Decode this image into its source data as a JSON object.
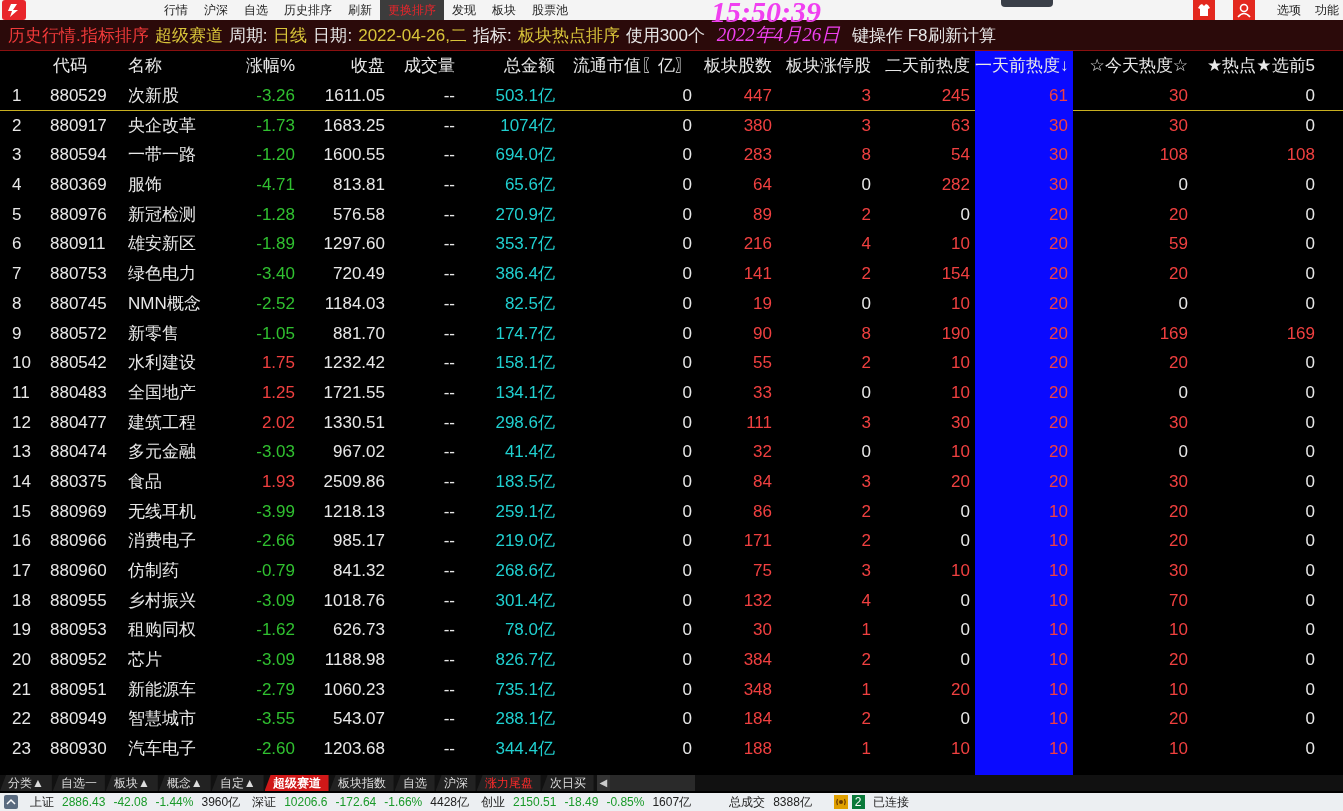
{
  "menu": [
    {
      "label": "行情",
      "selected": false
    },
    {
      "label": "沪深",
      "selected": false
    },
    {
      "label": "自选",
      "selected": false
    },
    {
      "label": "历史排序",
      "selected": false
    },
    {
      "label": "刷新",
      "selected": false
    },
    {
      "label": "更换排序",
      "selected": true
    },
    {
      "label": "发现",
      "selected": false
    },
    {
      "label": "板块",
      "selected": false
    },
    {
      "label": "股票池",
      "selected": false
    }
  ],
  "top_right": [
    "选项",
    "功能"
  ],
  "clock": {
    "time": "15:50:39",
    "date": "2022年4月26日"
  },
  "info_bar": {
    "title": "历史行情.指标排序",
    "track": "超级赛道",
    "period_label": "周期:",
    "period": "日线",
    "date_label": "日期:",
    "date": "2022-04-26,二",
    "indicator_label": "指标:",
    "indicator": "板块热点排序",
    "note_start": "使用300个",
    "note_end": "键操作 F8刷新计算"
  },
  "columns": [
    {
      "label": "代码",
      "sorted": false
    },
    {
      "label": "名称",
      "sorted": false
    },
    {
      "label": "涨幅%",
      "sorted": false
    },
    {
      "label": "收盘",
      "sorted": false
    },
    {
      "label": "成交量",
      "sorted": false
    },
    {
      "label": "总金额",
      "sorted": false
    },
    {
      "label": "流通市值〖亿〗",
      "sorted": false
    },
    {
      "label": "板块股数",
      "sorted": false
    },
    {
      "label": "板块涨停股",
      "sorted": false
    },
    {
      "label": "二天前热度",
      "sorted": false
    },
    {
      "label": "一天前热度↓",
      "sorted": true
    },
    {
      "label": "☆今天热度☆",
      "sorted": false
    },
    {
      "label": "★热点★选前5",
      "sorted": false
    }
  ],
  "rows": [
    {
      "selected": true,
      "up": false,
      "cells": [
        "1",
        "880529",
        "次新股",
        "-3.26",
        "1611.05",
        "--",
        "503.1亿",
        "0",
        "447",
        "3",
        "245",
        "61",
        "30",
        "0"
      ]
    },
    {
      "selected": false,
      "up": false,
      "cells": [
        "2",
        "880917",
        "央企改革",
        "-1.73",
        "1683.25",
        "--",
        "1074亿",
        "0",
        "380",
        "3",
        "63",
        "30",
        "30",
        "0"
      ]
    },
    {
      "selected": false,
      "up": false,
      "cells": [
        "3",
        "880594",
        "一带一路",
        "-1.20",
        "1600.55",
        "--",
        "694.0亿",
        "0",
        "283",
        "8",
        "54",
        "30",
        "108",
        "108"
      ]
    },
    {
      "selected": false,
      "up": false,
      "cells": [
        "4",
        "880369",
        "服饰",
        "-4.71",
        "813.81",
        "--",
        "65.6亿",
        "0",
        "64",
        "0",
        "282",
        "30",
        "0",
        "0"
      ]
    },
    {
      "selected": false,
      "up": false,
      "cells": [
        "5",
        "880976",
        "新冠检测",
        "-1.28",
        "576.58",
        "--",
        "270.9亿",
        "0",
        "89",
        "2",
        "0",
        "20",
        "20",
        "0"
      ]
    },
    {
      "selected": false,
      "up": false,
      "cells": [
        "6",
        "880911",
        "雄安新区",
        "-1.89",
        "1297.60",
        "--",
        "353.7亿",
        "0",
        "216",
        "4",
        "10",
        "20",
        "59",
        "0"
      ]
    },
    {
      "selected": false,
      "up": false,
      "cells": [
        "7",
        "880753",
        "绿色电力",
        "-3.40",
        "720.49",
        "--",
        "386.4亿",
        "0",
        "141",
        "2",
        "154",
        "20",
        "20",
        "0"
      ]
    },
    {
      "selected": false,
      "up": false,
      "cells": [
        "8",
        "880745",
        "NMN概念",
        "-2.52",
        "1184.03",
        "--",
        "82.5亿",
        "0",
        "19",
        "0",
        "10",
        "20",
        "0",
        "0"
      ]
    },
    {
      "selected": false,
      "up": false,
      "cells": [
        "9",
        "880572",
        "新零售",
        "-1.05",
        "881.70",
        "--",
        "174.7亿",
        "0",
        "90",
        "8",
        "190",
        "20",
        "169",
        "169"
      ]
    },
    {
      "selected": false,
      "up": true,
      "cells": [
        "10",
        "880542",
        "水利建设",
        "1.75",
        "1232.42",
        "--",
        "158.1亿",
        "0",
        "55",
        "2",
        "10",
        "20",
        "20",
        "0"
      ]
    },
    {
      "selected": false,
      "up": true,
      "cells": [
        "11",
        "880483",
        "全国地产",
        "1.25",
        "1721.55",
        "--",
        "134.1亿",
        "0",
        "33",
        "0",
        "10",
        "20",
        "0",
        "0"
      ]
    },
    {
      "selected": false,
      "up": true,
      "cells": [
        "12",
        "880477",
        "建筑工程",
        "2.02",
        "1330.51",
        "--",
        "298.6亿",
        "0",
        "111",
        "3",
        "30",
        "20",
        "30",
        "0"
      ]
    },
    {
      "selected": false,
      "up": false,
      "cells": [
        "13",
        "880474",
        "多元金融",
        "-3.03",
        "967.02",
        "--",
        "41.4亿",
        "0",
        "32",
        "0",
        "10",
        "20",
        "0",
        "0"
      ]
    },
    {
      "selected": false,
      "up": true,
      "cells": [
        "14",
        "880375",
        "食品",
        "1.93",
        "2509.86",
        "--",
        "183.5亿",
        "0",
        "84",
        "3",
        "20",
        "20",
        "30",
        "0"
      ]
    },
    {
      "selected": false,
      "up": false,
      "cells": [
        "15",
        "880969",
        "无线耳机",
        "-3.99",
        "1218.13",
        "--",
        "259.1亿",
        "0",
        "86",
        "2",
        "0",
        "10",
        "20",
        "0"
      ]
    },
    {
      "selected": false,
      "up": false,
      "cells": [
        "16",
        "880966",
        "消费电子",
        "-2.66",
        "985.17",
        "--",
        "219.0亿",
        "0",
        "171",
        "2",
        "0",
        "10",
        "20",
        "0"
      ]
    },
    {
      "selected": false,
      "up": false,
      "cells": [
        "17",
        "880960",
        "仿制药",
        "-0.79",
        "841.32",
        "--",
        "268.6亿",
        "0",
        "75",
        "3",
        "10",
        "10",
        "30",
        "0"
      ]
    },
    {
      "selected": false,
      "up": false,
      "cells": [
        "18",
        "880955",
        "乡村振兴",
        "-3.09",
        "1018.76",
        "--",
        "301.4亿",
        "0",
        "132",
        "4",
        "0",
        "10",
        "70",
        "0"
      ]
    },
    {
      "selected": false,
      "up": false,
      "cells": [
        "19",
        "880953",
        "租购同权",
        "-1.62",
        "626.73",
        "--",
        "78.0亿",
        "0",
        "30",
        "1",
        "0",
        "10",
        "10",
        "0"
      ]
    },
    {
      "selected": false,
      "up": false,
      "cells": [
        "20",
        "880952",
        "芯片",
        "-3.09",
        "1188.98",
        "--",
        "826.7亿",
        "0",
        "384",
        "2",
        "0",
        "10",
        "20",
        "0"
      ]
    },
    {
      "selected": false,
      "up": false,
      "cells": [
        "21",
        "880951",
        "新能源车",
        "-2.79",
        "1060.23",
        "--",
        "735.1亿",
        "0",
        "348",
        "1",
        "20",
        "10",
        "10",
        "0"
      ]
    },
    {
      "selected": false,
      "up": false,
      "cells": [
        "22",
        "880949",
        "智慧城市",
        "-3.55",
        "543.07",
        "--",
        "288.1亿",
        "0",
        "184",
        "2",
        "0",
        "10",
        "20",
        "0"
      ]
    },
    {
      "selected": false,
      "up": false,
      "cells": [
        "23",
        "880930",
        "汽车电子",
        "-2.60",
        "1203.68",
        "--",
        "344.4亿",
        "0",
        "188",
        "1",
        "10",
        "10",
        "10",
        "0"
      ]
    }
  ],
  "bottom_tabs": [
    {
      "label": "分类▲",
      "selected": false,
      "highlight": false
    },
    {
      "label": "自选一",
      "selected": false,
      "highlight": false
    },
    {
      "label": "板块▲",
      "selected": false,
      "highlight": false
    },
    {
      "label": "概念▲",
      "selected": false,
      "highlight": false
    },
    {
      "label": "自定▲",
      "selected": false,
      "highlight": false
    },
    {
      "label": "超级赛道",
      "selected": true,
      "highlight": false
    },
    {
      "label": "板块指数",
      "selected": false,
      "highlight": false
    },
    {
      "label": "自选",
      "selected": false,
      "highlight": false
    },
    {
      "label": "沪深",
      "selected": false,
      "highlight": false
    },
    {
      "label": "涨力尾盘",
      "selected": false,
      "highlight": true
    },
    {
      "label": "次日买",
      "selected": false,
      "highlight": false
    }
  ],
  "scroll_left": "◀",
  "status_bar": {
    "indices": [
      {
        "name": "上证",
        "price": "2886.43",
        "change": "-42.08",
        "percent": "-1.44%",
        "amount": "3960亿"
      },
      {
        "name": "深证",
        "price": "10206.6",
        "change": "-172.64",
        "percent": "-1.66%",
        "amount": "4428亿"
      },
      {
        "name": "创业",
        "price": "2150.51",
        "change": "-18.49",
        "percent": "-0.85%",
        "amount": "1607亿"
      }
    ],
    "total_label": "总成交",
    "total": "8388亿",
    "connections": "2",
    "connection_status": "已连接"
  }
}
